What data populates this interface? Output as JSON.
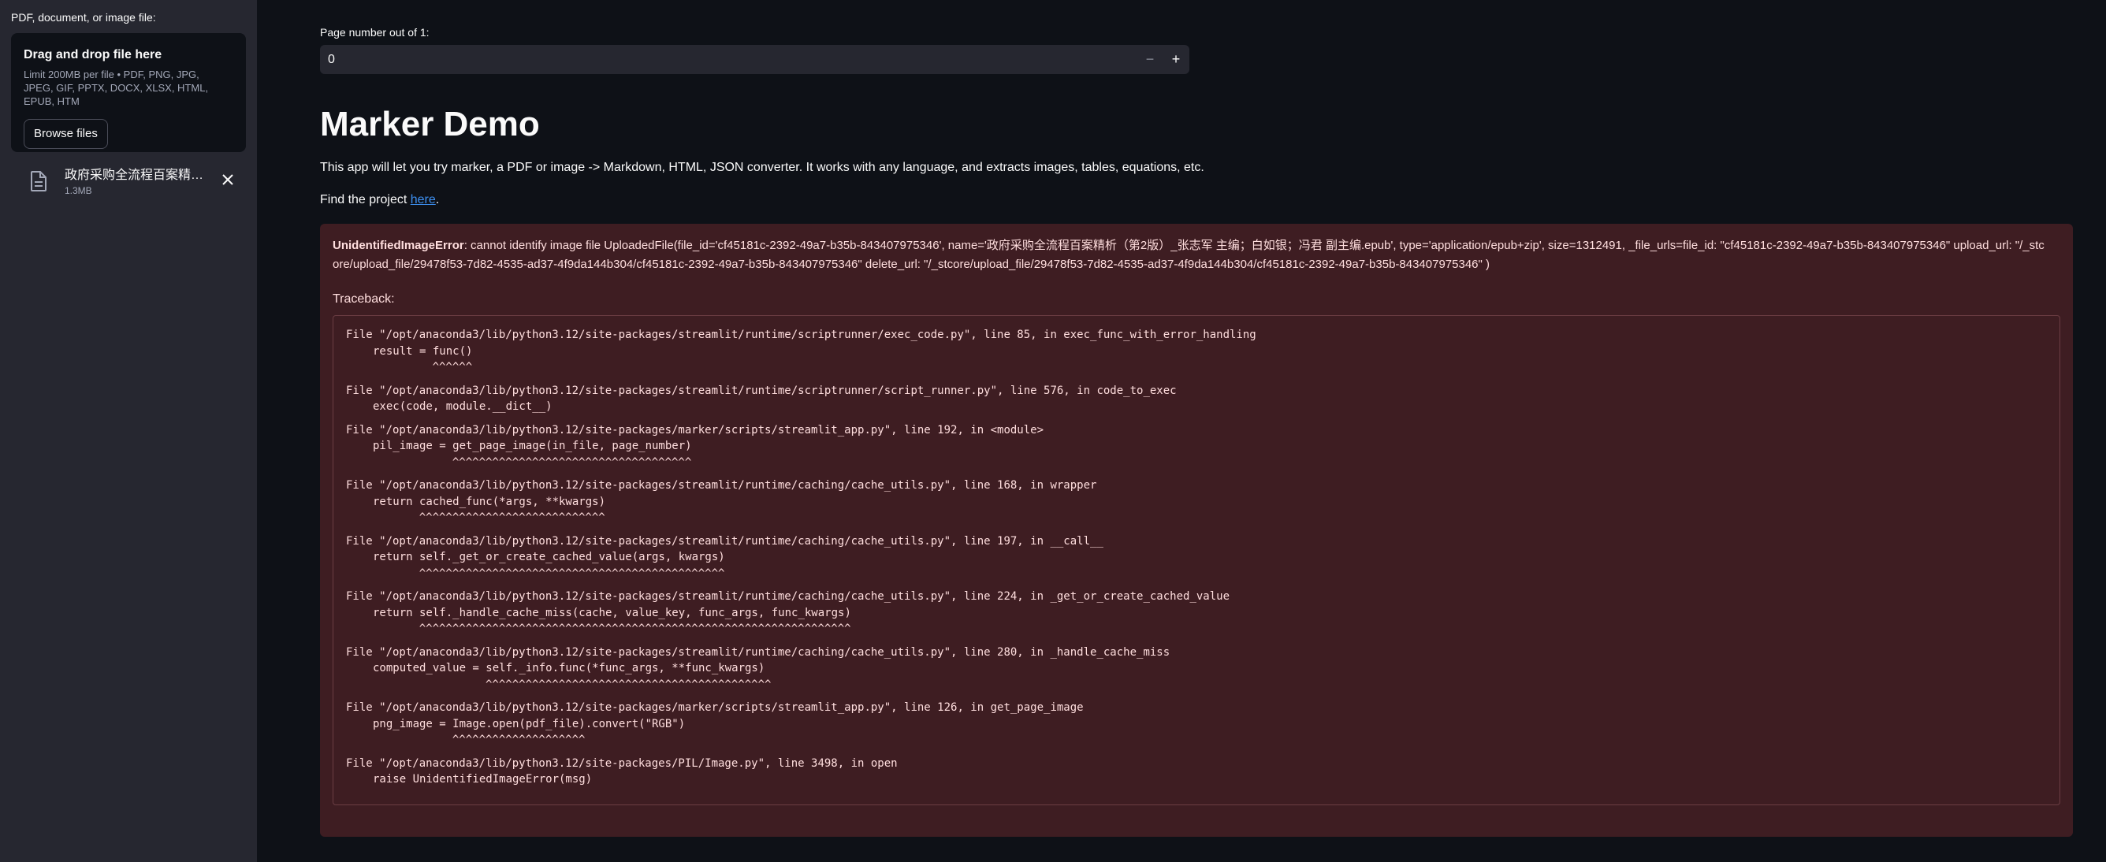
{
  "sidebar": {
    "uploader_label": "PDF, document, or image file:",
    "dropzone_title": "Drag and drop file here",
    "dropzone_sub": "Limit 200MB per file • PDF, PNG, JPG, JPEG, GIF, PPTX, DOCX, XLSX, HTML, EPUB, HTM",
    "browse_label": "Browse files",
    "file": {
      "name": "政府采购全流程百案精析（第2版）_张志军 主编；白如银；冯君 副主编.epub",
      "size": "1.3MB"
    }
  },
  "main": {
    "page_label": "Page number out of 1:",
    "page_value": "0",
    "title": "Marker Demo",
    "intro": "This app will let you try marker, a PDF or image -> Markdown, HTML, JSON converter. It works with any language, and extracts images, tables, equations, etc.",
    "find_prefix": "Find the project ",
    "find_link": "here",
    "find_suffix": "."
  },
  "error": {
    "type": "UnidentifiedImageError",
    "message": ": cannot identify image file UploadedFile(file_id='cf45181c-2392-49a7-b35b-843407975346', name='政府采购全流程百案精析（第2版）_张志军 主编；白如银；冯君 副主编.epub', type='application/epub+zip', size=1312491, _file_urls=file_id: \"cf45181c-2392-49a7-b35b-843407975346\" upload_url: \"/_stcore/upload_file/29478f53-7d82-4535-ad37-4f9da144b304/cf45181c-2392-49a7-b35b-843407975346\" delete_url: \"/_stcore/upload_file/29478f53-7d82-4535-ad37-4f9da144b304/cf45181c-2392-49a7-b35b-843407975346\" )",
    "traceback_label": "Traceback:",
    "frames": [
      {
        "file": "File \"/opt/anaconda3/lib/python3.12/site-packages/streamlit/runtime/scriptrunner/exec_code.py\", line 85, in exec_func_with_error_handling",
        "code": "result = func()",
        "caret": "             ^^^^^^"
      },
      {
        "file": "File \"/opt/anaconda3/lib/python3.12/site-packages/streamlit/runtime/scriptrunner/script_runner.py\", line 576, in code_to_exec",
        "code": "exec(code, module.__dict__)",
        "caret": ""
      },
      {
        "file": "File \"/opt/anaconda3/lib/python3.12/site-packages/marker/scripts/streamlit_app.py\", line 192, in <module>",
        "code": "pil_image = get_page_image(in_file, page_number)",
        "caret": "                ^^^^^^^^^^^^^^^^^^^^^^^^^^^^^^^^^^^^"
      },
      {
        "file": "File \"/opt/anaconda3/lib/python3.12/site-packages/streamlit/runtime/caching/cache_utils.py\", line 168, in wrapper",
        "code": "return cached_func(*args, **kwargs)",
        "caret": "           ^^^^^^^^^^^^^^^^^^^^^^^^^^^^"
      },
      {
        "file": "File \"/opt/anaconda3/lib/python3.12/site-packages/streamlit/runtime/caching/cache_utils.py\", line 197, in __call__",
        "code": "return self._get_or_create_cached_value(args, kwargs)",
        "caret": "           ^^^^^^^^^^^^^^^^^^^^^^^^^^^^^^^^^^^^^^^^^^^^^^"
      },
      {
        "file": "File \"/opt/anaconda3/lib/python3.12/site-packages/streamlit/runtime/caching/cache_utils.py\", line 224, in _get_or_create_cached_value",
        "code": "return self._handle_cache_miss(cache, value_key, func_args, func_kwargs)",
        "caret": "           ^^^^^^^^^^^^^^^^^^^^^^^^^^^^^^^^^^^^^^^^^^^^^^^^^^^^^^^^^^^^^^^^^"
      },
      {
        "file": "File \"/opt/anaconda3/lib/python3.12/site-packages/streamlit/runtime/caching/cache_utils.py\", line 280, in _handle_cache_miss",
        "code": "computed_value = self._info.func(*func_args, **func_kwargs)",
        "caret": "                     ^^^^^^^^^^^^^^^^^^^^^^^^^^^^^^^^^^^^^^^^^^^"
      },
      {
        "file": "File \"/opt/anaconda3/lib/python3.12/site-packages/marker/scripts/streamlit_app.py\", line 126, in get_page_image",
        "code": "png_image = Image.open(pdf_file).convert(\"RGB\")",
        "caret": "                ^^^^^^^^^^^^^^^^^^^^"
      },
      {
        "file": "File \"/opt/anaconda3/lib/python3.12/site-packages/PIL/Image.py\", line 3498, in open",
        "code": "raise UnidentifiedImageError(msg)",
        "caret": ""
      }
    ]
  },
  "colors": {
    "sidebar_bg": "#262730",
    "main_bg": "#0e1117",
    "error_bg": "#3e1d22",
    "error_text": "#ffdede",
    "link": "#3d8fef"
  },
  "icons": {
    "file": "file-icon",
    "close": "close-icon",
    "minus": "minus-icon",
    "plus": "plus-icon"
  }
}
